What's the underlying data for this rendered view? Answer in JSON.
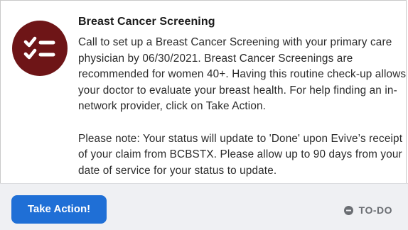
{
  "card": {
    "icon": "checklist-icon",
    "title": "Breast Cancer Screening",
    "description_lines": [
      "Call to set up a Breast Cancer Screening with your primary care",
      "physician by 06/30/2021. Breast Cancer Screenings are",
      "recommended for women 40+. Having this routine check-up allows",
      "your doctor to evaluate your breast health. For help finding an in-",
      "network provider, click on Take Action."
    ],
    "note_lines": [
      "Please note: Your status will update to 'Done' upon Evive’s receipt",
      "of your claim from BCBSTX. Please allow up to 90 days from your",
      "date of service for your status to update."
    ]
  },
  "footer": {
    "action_label": "Take Action!",
    "status_icon": "minus-circle-icon",
    "status_label": "TO-DO"
  },
  "colors": {
    "icon_bg": "#6e1517",
    "button_bg": "#1f6fd6",
    "footer_bg": "#eff0f3",
    "status_text": "#6b6e73"
  }
}
